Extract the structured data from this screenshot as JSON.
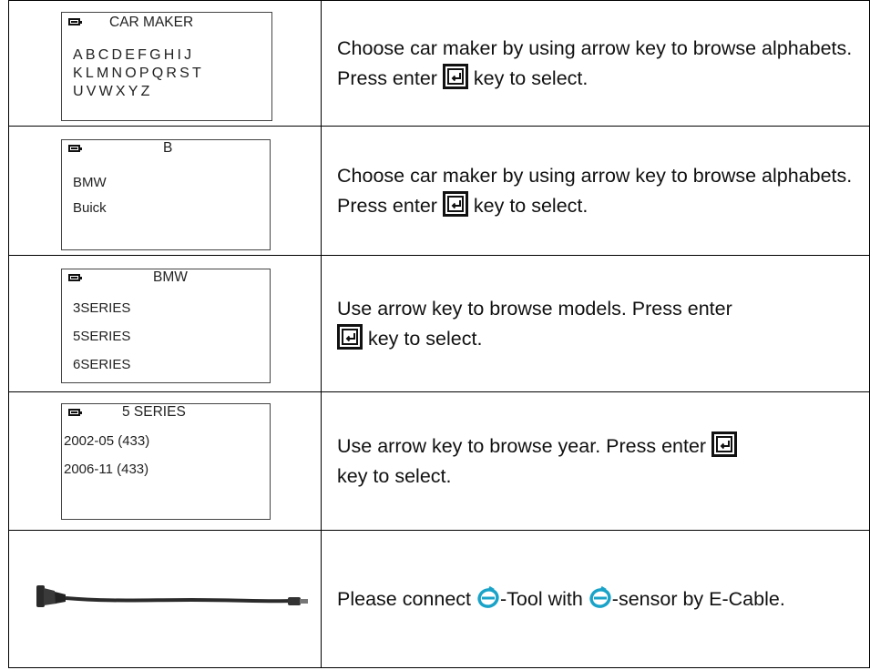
{
  "rows": [
    {
      "screen": {
        "title": "CAR MAKER",
        "lines": [
          "ABCDEFGHIJ",
          "KLMNOPQRST",
          "UVWXYZ"
        ]
      },
      "text_before": "Choose car maker by using arrow key to browse alphabets. Press enter ",
      "text_after": " key to select."
    },
    {
      "screen": {
        "title": "B",
        "lines": [
          "BMW",
          "Buick"
        ]
      },
      "text_before": "Choose car maker by using arrow key to browse alphabets. Press enter ",
      "text_after": " key to select."
    },
    {
      "screen": {
        "title": "BMW",
        "lines": [
          "3SERIES",
          "5SERIES",
          "6SERIES"
        ]
      },
      "text_before": "Use arrow key to browse models. Press enter ",
      "text_after": " key to select."
    },
    {
      "screen": {
        "title": "5 SERIES",
        "lines": [
          "2002-05 (433)",
          "2006-11 (433)"
        ]
      },
      "text_before": "Use arrow key to browse year. Press enter ",
      "text_after": " key to select."
    },
    {
      "cable_image": "e-cable",
      "text_parts": [
        "Please connect ",
        "-Tool with ",
        "-sensor by E-Cable."
      ]
    }
  ],
  "icons": {
    "enter": "enter-key-icon",
    "battery": "battery-icon",
    "logo": "e-logo-icon"
  },
  "colors": {
    "logo": "#1aa3c8",
    "border": "#000000",
    "text": "#111111"
  }
}
